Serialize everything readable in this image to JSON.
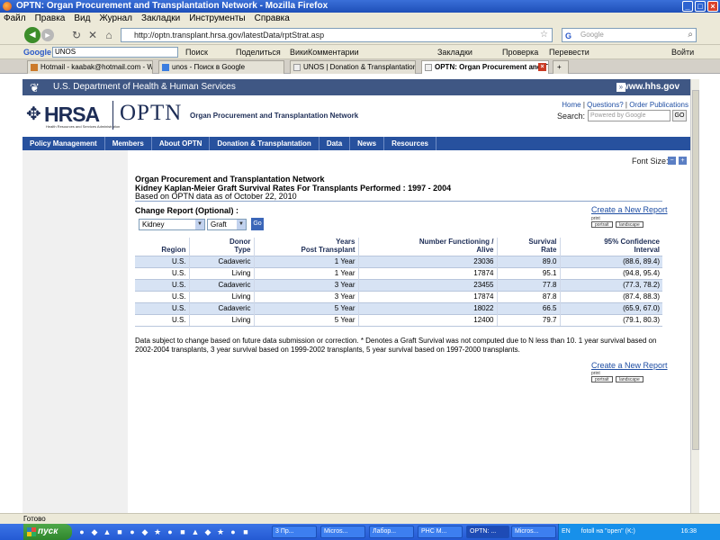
{
  "window": {
    "title": "OPTN: Organ Procurement and Transplantation Network - Mozilla Firefox"
  },
  "menu": [
    "Файл",
    "Правка",
    "Вид",
    "Журнал",
    "Закладки",
    "Инструменты",
    "Справка"
  ],
  "navbar": {
    "url": "http://optn.transplant.hrsa.gov/latestData/rptStrat.asp",
    "search_placeholder": "Google"
  },
  "google_toolbar": {
    "logo": "Google",
    "query": "UNOS",
    "items": [
      "Поиск",
      "Поделиться",
      "ВикиКомментарии",
      "Закладки",
      "Проверка",
      "Перевести",
      "Войти"
    ]
  },
  "tabs": [
    {
      "label": "Hotmail - kaabak@hotmail.com - Windo..."
    },
    {
      "label": "unos - Поиск в Google"
    },
    {
      "label": "UNOS | Donation & Transplantation | D..."
    },
    {
      "label": "OPTN: Organ Procurement and Tr..."
    }
  ],
  "site": {
    "hhs_title": "U.S. Department of Health & Human Services",
    "hhs_link": "www.hhs.gov",
    "hrsa_logo": "HRSA",
    "hrsa_subtitle": "Health Resources and Services Administration",
    "optn_logo": "OPTN",
    "optn_name": "Organ Procurement and Transplantation Network",
    "top_links": [
      "Home",
      "Questions?",
      "Order Publications"
    ],
    "search_label": "Search:",
    "search_placeholder": "Powered by Google",
    "search_go": "GO",
    "nav": [
      "Policy Management",
      "Members",
      "About OPTN",
      "Donation & Transplantation",
      "Data",
      "News",
      "Resources"
    ]
  },
  "report": {
    "font_size_label": "Font Size:",
    "title_line1": "Organ Procurement and Transplantation Network",
    "title_line2": "Kidney Kaplan-Meier Graft Survival Rates For Transplants Performed : 1997 - 2004",
    "based_on": "Based on OPTN data as of October 22, 2010",
    "change_label": "Change Report (Optional) :",
    "create_link": "Create a New Report",
    "print_label": "print",
    "portrait": "portrait",
    "landscape": "landscape",
    "organ_select": "Kidney",
    "type_select": "Graft",
    "go_label": "Go",
    "headers": {
      "region": "Region",
      "donor1": "Donor",
      "donor2": "Type",
      "years1": "Years",
      "years2": "Post Transplant",
      "func1": "Number Functioning /",
      "func2": "Alive",
      "surv1": "Survival",
      "surv2": "Rate",
      "ci1": "95% Confidence",
      "ci2": "Interval"
    },
    "rows": [
      [
        "U.S.",
        "Cadaveric",
        "1 Year",
        "23036",
        "89.0",
        "(88.6, 89.4)"
      ],
      [
        "U.S.",
        "Living",
        "1 Year",
        "17874",
        "95.1",
        "(94.8, 95.4)"
      ],
      [
        "U.S.",
        "Cadaveric",
        "3 Year",
        "23455",
        "77.8",
        "(77.3, 78.2)"
      ],
      [
        "U.S.",
        "Living",
        "3 Year",
        "17874",
        "87.8",
        "(87.4, 88.3)"
      ],
      [
        "U.S.",
        "Cadaveric",
        "5 Year",
        "18022",
        "66.5",
        "(65.9, 67.0)"
      ],
      [
        "U.S.",
        "Living",
        "5 Year",
        "12400",
        "79.7",
        "(79.1, 80.3)"
      ]
    ],
    "footnote": "Data subject to change based on future data submission or correction. * Denotes a Graft Survival was not computed due to N less than 10.  1 year survival based on 2002-2004 transplants, 3 year survival based on 1999-2002 transplants, 5 year survival based on 1997-2000 transplants."
  },
  "statusbar": {
    "text": "Готово"
  },
  "taskbar": {
    "start": "пуск",
    "items": [
      "3 Пр...",
      "Micros...",
      "Лабор...",
      "РНС М...",
      "OPTN: ...",
      "Micros..."
    ],
    "lang": "EN",
    "tray_text": "fotoll на \"open\" (K:)",
    "clock": "16:38"
  }
}
